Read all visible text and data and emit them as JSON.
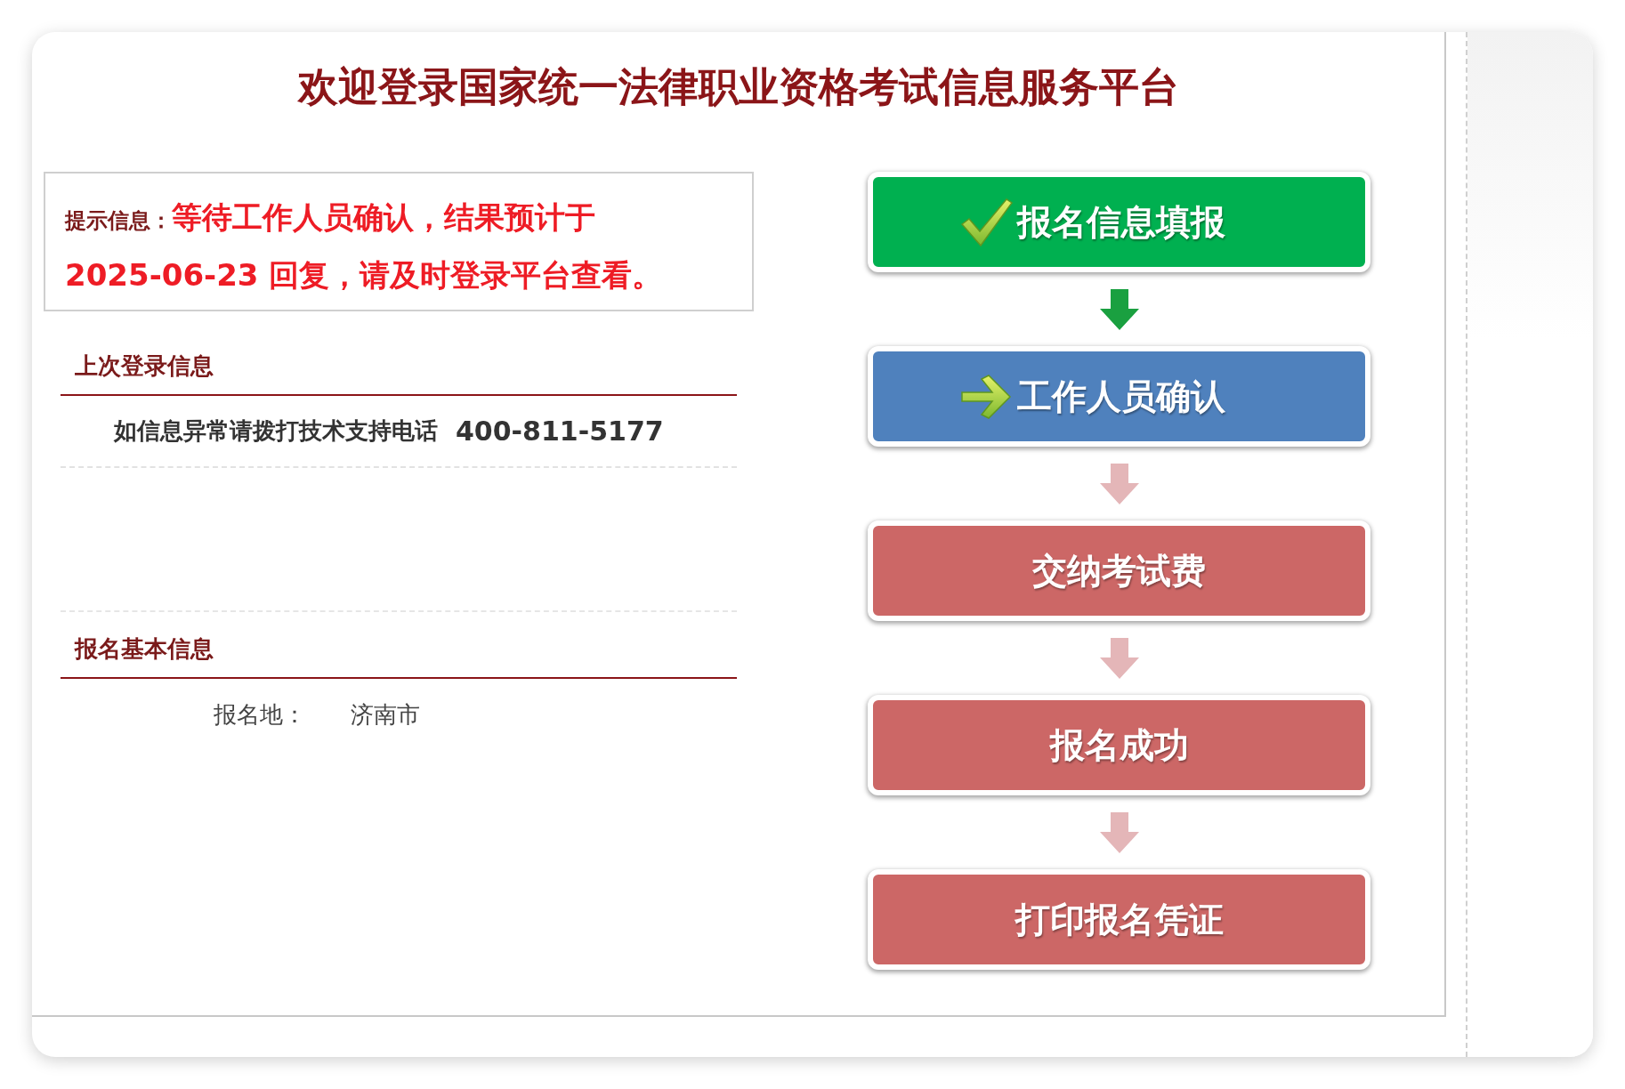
{
  "title": "欢迎登录国家统一法律职业资格考试信息服务平台",
  "notice": {
    "label": "提示信息：",
    "message": "等待工作人员确认，结果预计于 2025-06-23 回复，请及时登录平台查看。"
  },
  "sections": [
    {
      "heading": "上次登录信息",
      "rows": [
        {
          "kind": "phone",
          "label": "如信息异常请拨打技术支持电话",
          "value": "400-811-5177"
        }
      ]
    },
    {
      "heading": "报名基本信息",
      "rows": [
        {
          "kind": "field",
          "label": "报名地：",
          "value": "济南市"
        }
      ]
    }
  ],
  "steps": [
    {
      "label": "报名信息填报",
      "kind": "done"
    },
    {
      "label": "工作人员确认",
      "kind": "current"
    },
    {
      "label": "交纳考试费",
      "kind": "pending"
    },
    {
      "label": "报名成功",
      "kind": "pending"
    },
    {
      "label": "打印报名凭证",
      "kind": "pending"
    }
  ]
}
